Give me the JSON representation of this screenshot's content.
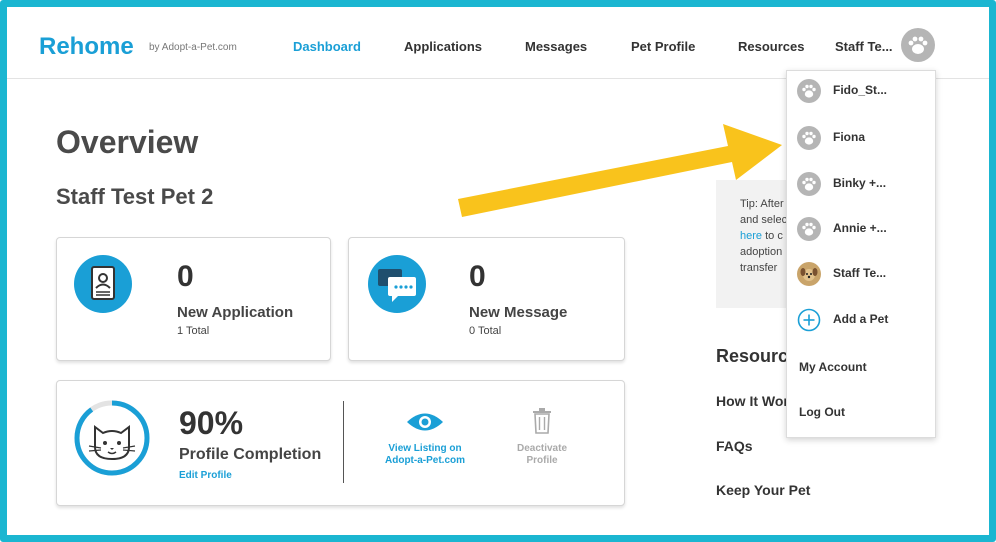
{
  "nav": {
    "logo": "Rehome",
    "logo_by": "by Adopt-a-Pet.com",
    "links": [
      "Dashboard",
      "Applications",
      "Messages",
      "Pet Profile",
      "Resources"
    ],
    "active": "Dashboard",
    "user_name": "Staff Te..."
  },
  "main": {
    "title": "Overview",
    "pet_name": "Staff Test Pet 2",
    "applications": {
      "count": "0",
      "label": "New Application",
      "total": "1 Total"
    },
    "messages": {
      "count": "0",
      "label": "New Message",
      "total": "0 Total"
    },
    "profile": {
      "percent": "90%",
      "percent_value": 0.9,
      "label": "Profile Completion",
      "edit_link": "Edit Profile",
      "view_listing_line1": "View Listing on",
      "view_listing_line2": "Adopt-a-Pet.com",
      "deactivate_line1": "Deactivate",
      "deactivate_line2": "Profile"
    }
  },
  "tip": {
    "lines": [
      "Tip: After",
      "and select",
      "here",
      "adoption",
      "transfer"
    ],
    "line3_suffix": " to c"
  },
  "resources": {
    "heading": "Resources",
    "items": [
      "How It Works",
      "FAQs",
      "Keep Your Pet"
    ]
  },
  "dropdown": {
    "pets": [
      "Fido_St...",
      "Fiona",
      "Binky +...",
      "Annie +...",
      "Staff Te..."
    ],
    "add_pet": "Add a Pet",
    "my_account": "My Account",
    "log_out": "Log Out"
  },
  "colors": {
    "brand": "#1a9fd6",
    "frame": "#1bb6d1",
    "arrow": "#f9c31c"
  }
}
